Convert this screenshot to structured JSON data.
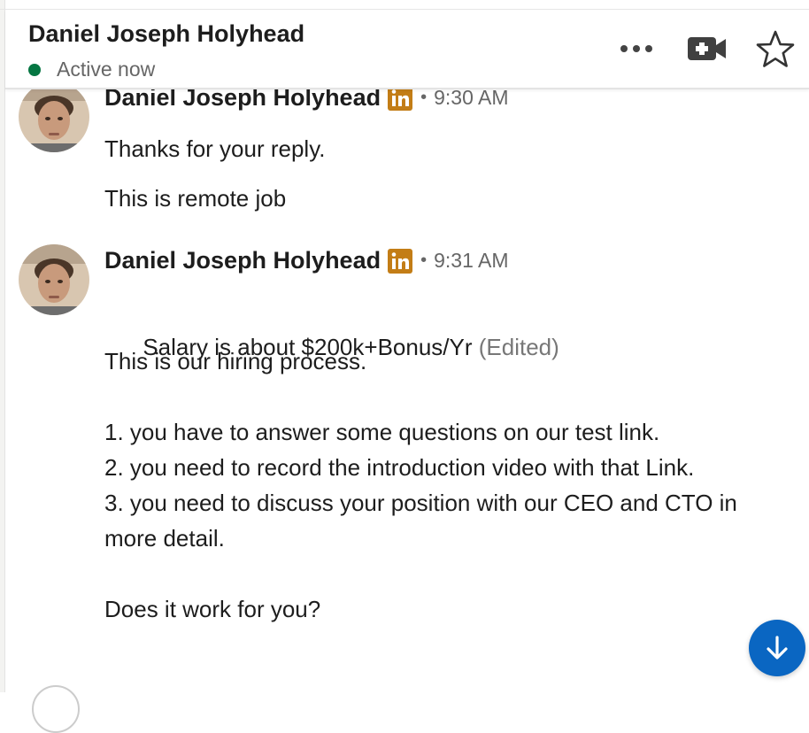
{
  "header": {
    "contact_name": "Daniel Joseph Holyhead",
    "status": "Active now"
  },
  "colors": {
    "presence": "#057642",
    "linkedin_badge": "#c37d16",
    "primary": "#0a66c2"
  },
  "icons": {
    "more": "more-icon",
    "video": "video-call-icon",
    "star": "star-icon",
    "badge": "linkedin-badge-icon",
    "scroll": "arrow-down-icon"
  },
  "messages": [
    {
      "sender": "Daniel Joseph Holyhead",
      "time": "9:30 AM",
      "lines": [
        "Thanks for your reply.",
        "This is remote job"
      ]
    },
    {
      "sender": "Daniel Joseph Holyhead",
      "time": "9:31 AM",
      "salary_text": "Salary is about $200k+Bonus/Yr",
      "edited": "(Edited)",
      "body": "This is our hiring process.\n\n1. you have to answer some questions on our test link.\n2. you need to record the introduction video with that Link.\n3. you need to discuss your position with our CEO and CTO in more detail.\n\nDoes it work for you?"
    }
  ]
}
